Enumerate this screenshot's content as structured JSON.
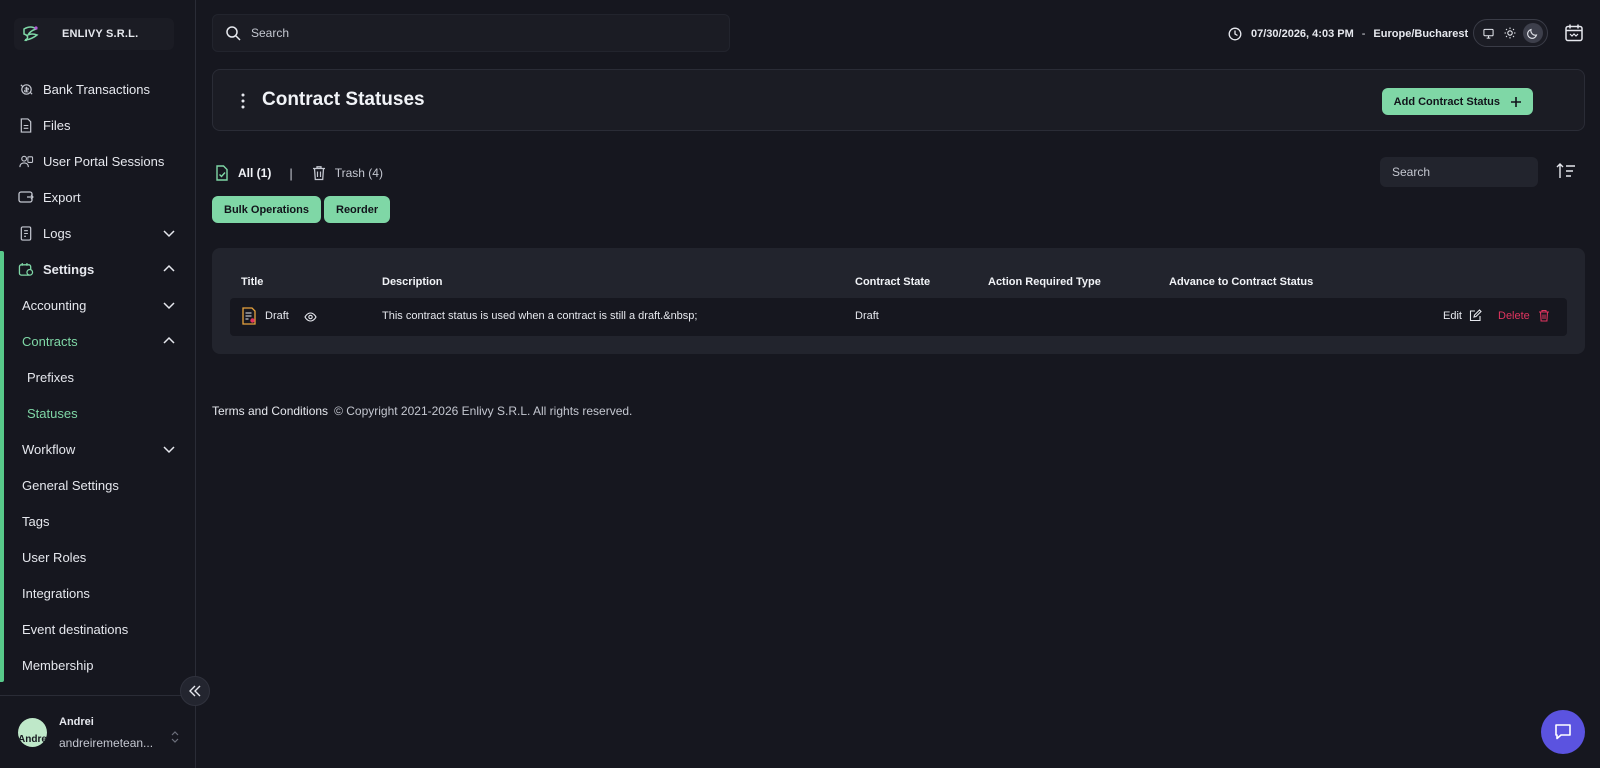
{
  "org": {
    "name": "ENLIVY S.R.L."
  },
  "nav": {
    "bank_transactions": "Bank Transactions",
    "files": "Files",
    "user_portal_sessions": "User Portal Sessions",
    "export": "Export",
    "logs": "Logs",
    "settings": "Settings",
    "accounting": "Accounting",
    "contracts": "Contracts",
    "prefixes": "Prefixes",
    "statuses": "Statuses",
    "workflow": "Workflow",
    "general_settings": "General Settings",
    "tags": "Tags",
    "user_roles": "User Roles",
    "integrations": "Integrations",
    "event_destinations": "Event destinations",
    "membership": "Membership"
  },
  "user": {
    "name": "Andrei",
    "email": "andreiremetean...",
    "avatar_text": "Andre"
  },
  "topbar": {
    "search_placeholder": "Search",
    "datetime": "07/30/2026, 4:03 PM",
    "separator": "-",
    "timezone": "Europe/Bucharest"
  },
  "page": {
    "title": "Contract Statuses",
    "add_button": "Add Contract Status"
  },
  "filters": {
    "all": "All (1)",
    "separator": "|",
    "trash": "Trash (4)",
    "search_placeholder": "Search",
    "bulk_operations": "Bulk Operations",
    "reorder": "Reorder"
  },
  "table": {
    "columns": [
      "Title",
      "Description",
      "Contract State",
      "Action Required Type",
      "Advance to Contract Status"
    ],
    "rows": [
      {
        "title": "Draft",
        "description": "This contract status is used when a contract is still a draft.&nbsp;",
        "contract_state": "Draft",
        "action_required_type": "",
        "advance_to": "",
        "edit": "Edit",
        "delete": "Delete"
      }
    ]
  },
  "footer": {
    "terms": "Terms and Conditions",
    "copyright": "© Copyright 2021-2026 Enlivy S.R.L. All rights reserved."
  },
  "colors": {
    "accent": "#7fd7a6",
    "danger": "#e0345f",
    "chat": "#5b53e0",
    "background": "#16171f"
  }
}
